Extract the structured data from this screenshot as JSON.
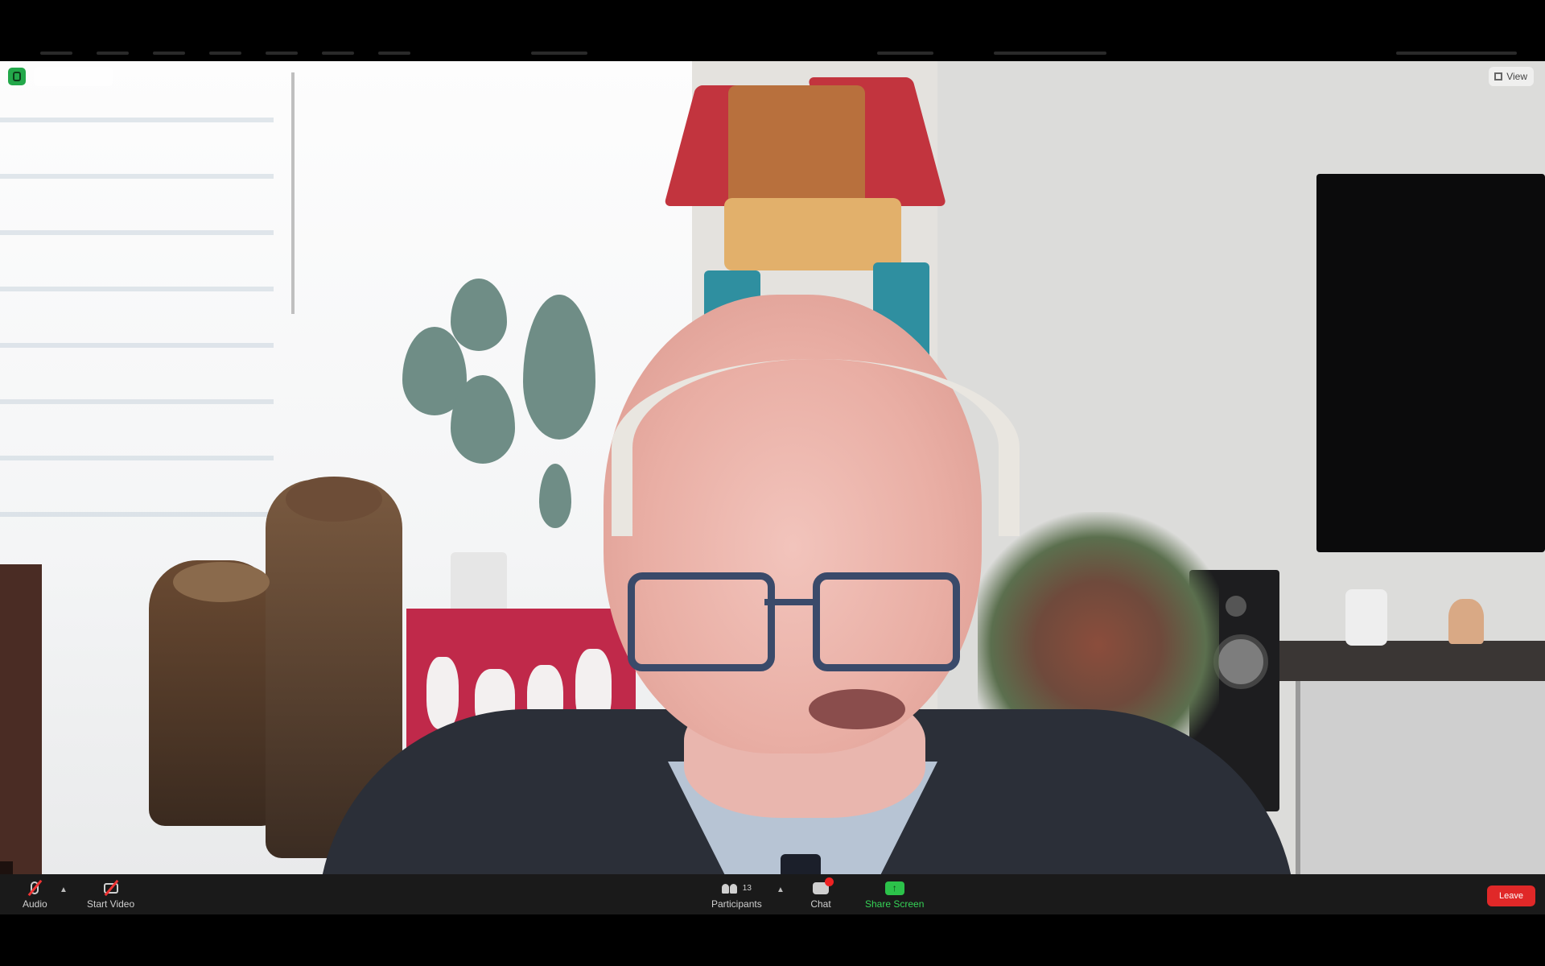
{
  "window": {
    "view_label": "View",
    "speaker_name_tag": "",
    "view_pill_label": ""
  },
  "toolbar": {
    "audio_label": "Audio",
    "video_label": "Start Video",
    "participants_label": "Participants",
    "participants_count": "13",
    "chat_label": "Chat",
    "share_label": "Share Screen",
    "leave_label": "Leave"
  },
  "icons": {
    "security": "shield-icon",
    "view": "grid-icon",
    "audio": "microphone-muted-icon",
    "video": "camera-off-icon",
    "participants": "people-icon",
    "chat": "chat-bubble-icon",
    "share": "share-screen-icon"
  },
  "colors": {
    "share_green": "#2cc24a",
    "leave_red": "#e02828",
    "security_green": "#23a84a",
    "toolbar_bg": "#1a1a1a"
  }
}
